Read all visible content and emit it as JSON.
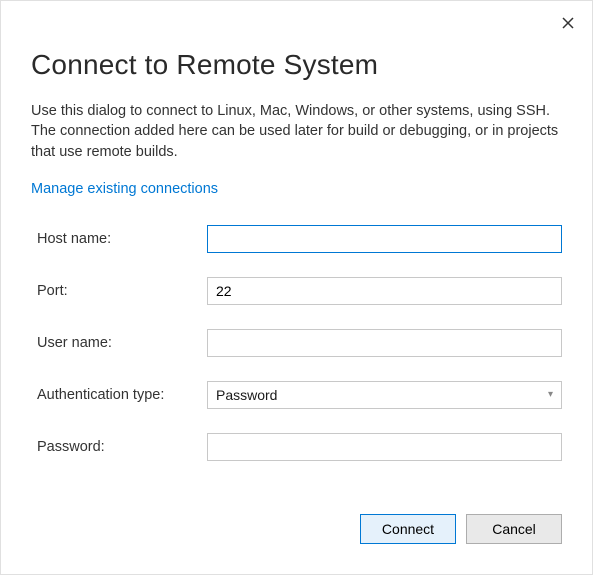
{
  "dialog": {
    "title": "Connect to Remote System",
    "description": "Use this dialog to connect to Linux, Mac, Windows, or other systems, using SSH. The connection added here can be used later for build or debugging, or in projects that use remote builds.",
    "link_text": "Manage existing connections"
  },
  "form": {
    "hostname": {
      "label": "Host name:",
      "value": ""
    },
    "port": {
      "label": "Port:",
      "value": "22"
    },
    "username": {
      "label": "User name:",
      "value": ""
    },
    "authtype": {
      "label": "Authentication type:",
      "value": "Password"
    },
    "password": {
      "label": "Password:",
      "value": ""
    }
  },
  "buttons": {
    "connect": "Connect",
    "cancel": "Cancel"
  }
}
